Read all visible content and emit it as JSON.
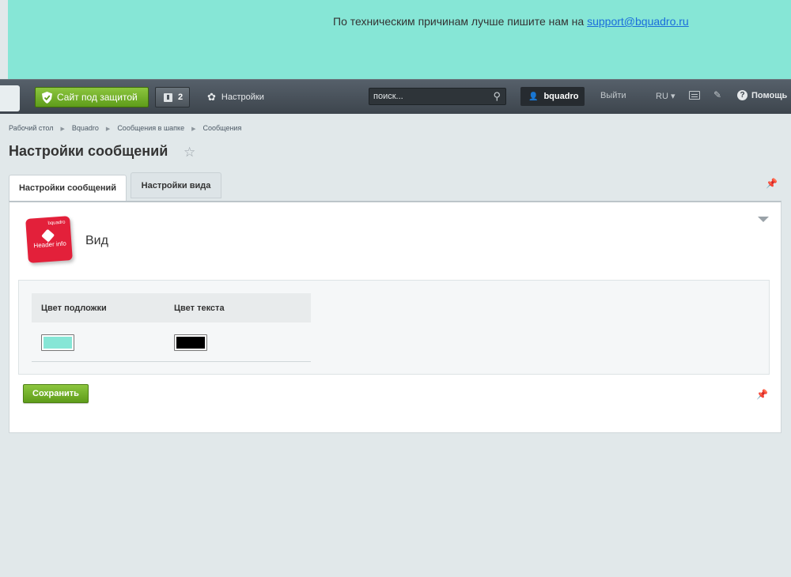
{
  "notice": {
    "text": "По техническим причинам лучше пишите нам на ",
    "link": "support@bquadro.ru",
    "background": "#86e6d6"
  },
  "panel": {
    "protect_label": "Сайт под защитой",
    "notifications_count": "2",
    "settings_label": "Настройки",
    "search_placeholder": "поиск...",
    "username": "bquadro",
    "logout_label": "Выйти",
    "language": "RU",
    "help_label": "Помощь"
  },
  "breadcrumb": [
    "Рабочий стол",
    "Bquadro",
    "Сообщения в шапке",
    "Сообщения"
  ],
  "page_title": "Настройки сообщений",
  "tabs": [
    {
      "label": "Настройки сообщений",
      "active": true
    },
    {
      "label": "Настройки вида",
      "active": false
    }
  ],
  "section": {
    "title": "Вид",
    "logo_brand": "bquadro",
    "logo_text": "Header info"
  },
  "settings_table": {
    "columns": [
      "Цвет подложки",
      "Цвет текста"
    ],
    "values": {
      "background_color": "#86e6d6",
      "text_color": "#000000"
    }
  },
  "save_label": "Сохранить"
}
